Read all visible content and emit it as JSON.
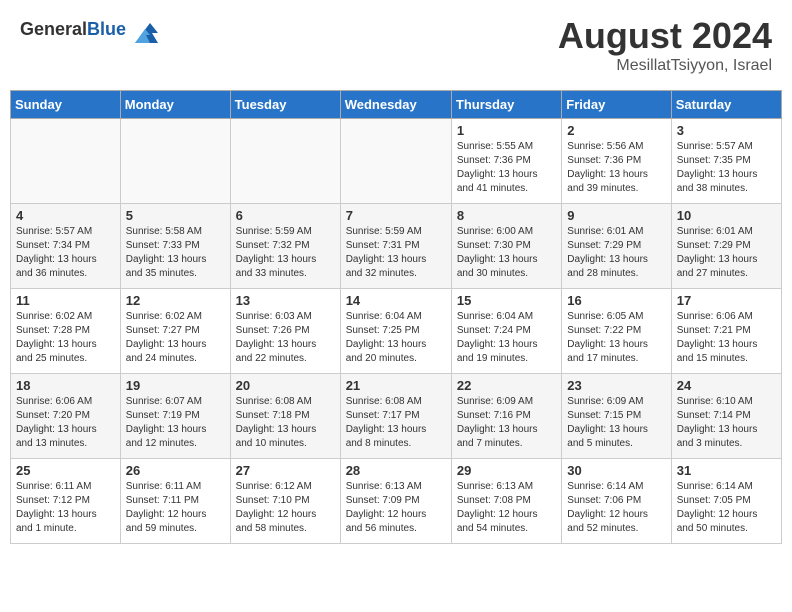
{
  "header": {
    "logo_line1": "General",
    "logo_line2": "Blue",
    "month_year": "August 2024",
    "location": "MesillatTsiyyon, Israel"
  },
  "weekdays": [
    "Sunday",
    "Monday",
    "Tuesday",
    "Wednesday",
    "Thursday",
    "Friday",
    "Saturday"
  ],
  "weeks": [
    [
      {
        "day": "",
        "info": ""
      },
      {
        "day": "",
        "info": ""
      },
      {
        "day": "",
        "info": ""
      },
      {
        "day": "",
        "info": ""
      },
      {
        "day": "1",
        "info": "Sunrise: 5:55 AM\nSunset: 7:36 PM\nDaylight: 13 hours\nand 41 minutes."
      },
      {
        "day": "2",
        "info": "Sunrise: 5:56 AM\nSunset: 7:36 PM\nDaylight: 13 hours\nand 39 minutes."
      },
      {
        "day": "3",
        "info": "Sunrise: 5:57 AM\nSunset: 7:35 PM\nDaylight: 13 hours\nand 38 minutes."
      }
    ],
    [
      {
        "day": "4",
        "info": "Sunrise: 5:57 AM\nSunset: 7:34 PM\nDaylight: 13 hours\nand 36 minutes."
      },
      {
        "day": "5",
        "info": "Sunrise: 5:58 AM\nSunset: 7:33 PM\nDaylight: 13 hours\nand 35 minutes."
      },
      {
        "day": "6",
        "info": "Sunrise: 5:59 AM\nSunset: 7:32 PM\nDaylight: 13 hours\nand 33 minutes."
      },
      {
        "day": "7",
        "info": "Sunrise: 5:59 AM\nSunset: 7:31 PM\nDaylight: 13 hours\nand 32 minutes."
      },
      {
        "day": "8",
        "info": "Sunrise: 6:00 AM\nSunset: 7:30 PM\nDaylight: 13 hours\nand 30 minutes."
      },
      {
        "day": "9",
        "info": "Sunrise: 6:01 AM\nSunset: 7:29 PM\nDaylight: 13 hours\nand 28 minutes."
      },
      {
        "day": "10",
        "info": "Sunrise: 6:01 AM\nSunset: 7:29 PM\nDaylight: 13 hours\nand 27 minutes."
      }
    ],
    [
      {
        "day": "11",
        "info": "Sunrise: 6:02 AM\nSunset: 7:28 PM\nDaylight: 13 hours\nand 25 minutes."
      },
      {
        "day": "12",
        "info": "Sunrise: 6:02 AM\nSunset: 7:27 PM\nDaylight: 13 hours\nand 24 minutes."
      },
      {
        "day": "13",
        "info": "Sunrise: 6:03 AM\nSunset: 7:26 PM\nDaylight: 13 hours\nand 22 minutes."
      },
      {
        "day": "14",
        "info": "Sunrise: 6:04 AM\nSunset: 7:25 PM\nDaylight: 13 hours\nand 20 minutes."
      },
      {
        "day": "15",
        "info": "Sunrise: 6:04 AM\nSunset: 7:24 PM\nDaylight: 13 hours\nand 19 minutes."
      },
      {
        "day": "16",
        "info": "Sunrise: 6:05 AM\nSunset: 7:22 PM\nDaylight: 13 hours\nand 17 minutes."
      },
      {
        "day": "17",
        "info": "Sunrise: 6:06 AM\nSunset: 7:21 PM\nDaylight: 13 hours\nand 15 minutes."
      }
    ],
    [
      {
        "day": "18",
        "info": "Sunrise: 6:06 AM\nSunset: 7:20 PM\nDaylight: 13 hours\nand 13 minutes."
      },
      {
        "day": "19",
        "info": "Sunrise: 6:07 AM\nSunset: 7:19 PM\nDaylight: 13 hours\nand 12 minutes."
      },
      {
        "day": "20",
        "info": "Sunrise: 6:08 AM\nSunset: 7:18 PM\nDaylight: 13 hours\nand 10 minutes."
      },
      {
        "day": "21",
        "info": "Sunrise: 6:08 AM\nSunset: 7:17 PM\nDaylight: 13 hours\nand 8 minutes."
      },
      {
        "day": "22",
        "info": "Sunrise: 6:09 AM\nSunset: 7:16 PM\nDaylight: 13 hours\nand 7 minutes."
      },
      {
        "day": "23",
        "info": "Sunrise: 6:09 AM\nSunset: 7:15 PM\nDaylight: 13 hours\nand 5 minutes."
      },
      {
        "day": "24",
        "info": "Sunrise: 6:10 AM\nSunset: 7:14 PM\nDaylight: 13 hours\nand 3 minutes."
      }
    ],
    [
      {
        "day": "25",
        "info": "Sunrise: 6:11 AM\nSunset: 7:12 PM\nDaylight: 13 hours\nand 1 minute."
      },
      {
        "day": "26",
        "info": "Sunrise: 6:11 AM\nSunset: 7:11 PM\nDaylight: 12 hours\nand 59 minutes."
      },
      {
        "day": "27",
        "info": "Sunrise: 6:12 AM\nSunset: 7:10 PM\nDaylight: 12 hours\nand 58 minutes."
      },
      {
        "day": "28",
        "info": "Sunrise: 6:13 AM\nSunset: 7:09 PM\nDaylight: 12 hours\nand 56 minutes."
      },
      {
        "day": "29",
        "info": "Sunrise: 6:13 AM\nSunset: 7:08 PM\nDaylight: 12 hours\nand 54 minutes."
      },
      {
        "day": "30",
        "info": "Sunrise: 6:14 AM\nSunset: 7:06 PM\nDaylight: 12 hours\nand 52 minutes."
      },
      {
        "day": "31",
        "info": "Sunrise: 6:14 AM\nSunset: 7:05 PM\nDaylight: 12 hours\nand 50 minutes."
      }
    ]
  ]
}
